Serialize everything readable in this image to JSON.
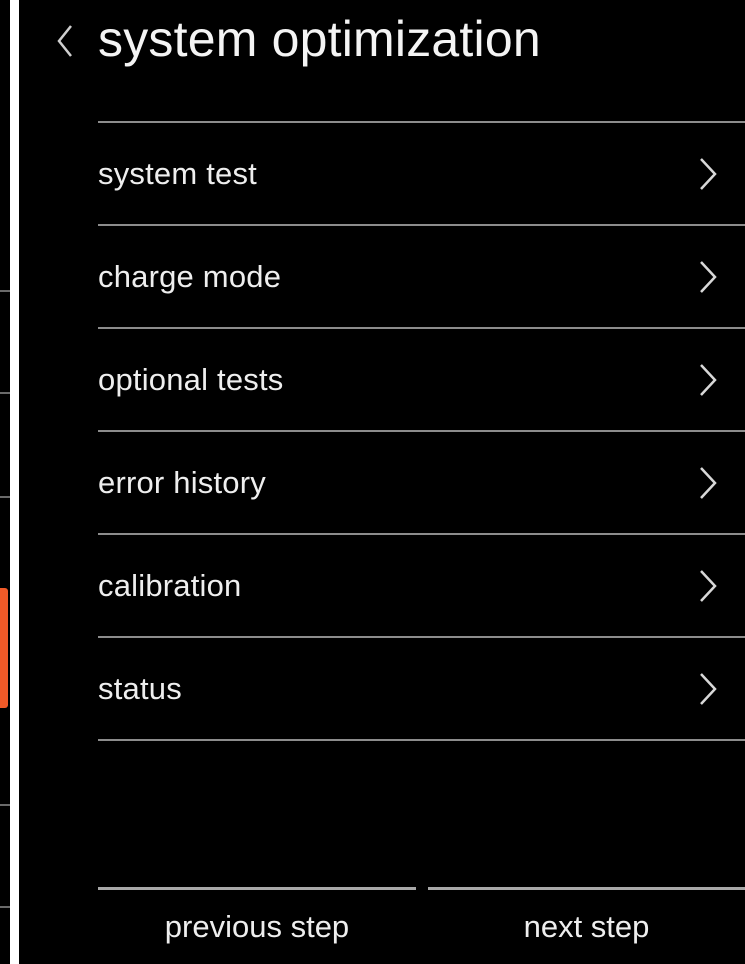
{
  "header": {
    "title": "system optimization",
    "back_icon": "chevron-left-icon"
  },
  "menu": {
    "items": [
      {
        "label": "system test",
        "icon": "chevron-right-icon"
      },
      {
        "label": "charge mode",
        "icon": "chevron-right-icon"
      },
      {
        "label": "optional tests",
        "icon": "chevron-right-icon"
      },
      {
        "label": "error history",
        "icon": "chevron-right-icon"
      },
      {
        "label": "calibration",
        "icon": "chevron-right-icon"
      },
      {
        "label": "status",
        "icon": "chevron-right-icon"
      }
    ]
  },
  "footer": {
    "previous_label": "previous step",
    "next_label": "next step"
  },
  "colors": {
    "background": "#000000",
    "text": "#eeeeee",
    "divider": "#8c8c8c",
    "accent": "#f05a28"
  }
}
